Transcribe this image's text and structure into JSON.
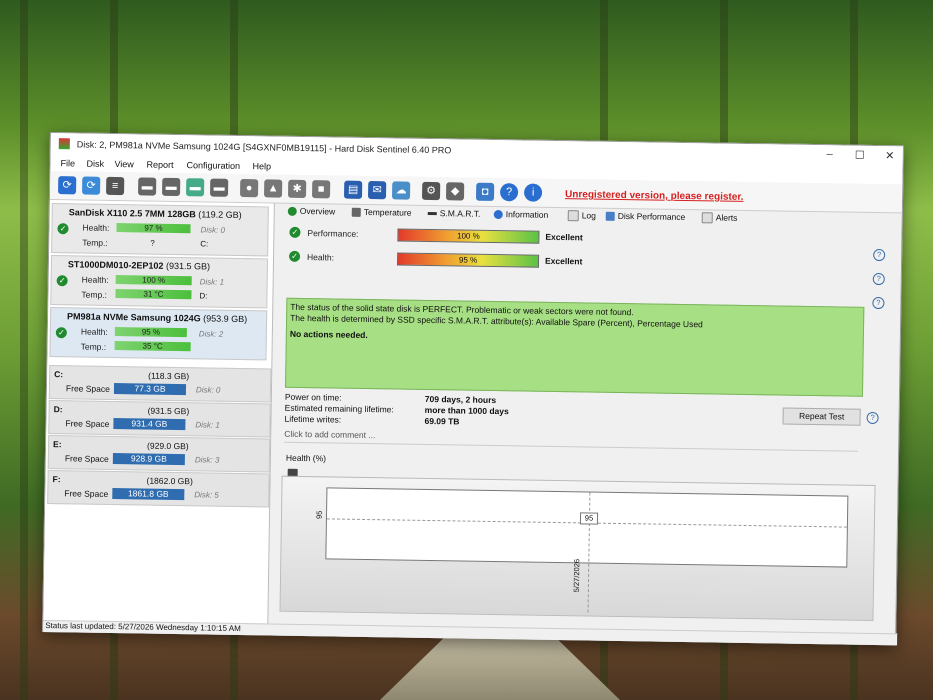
{
  "window": {
    "title": "Disk: 2, PM981a NVMe Samsung 1024G [S4GXNF0MB19115] - Hard Disk Sentinel 6.40 PRO",
    "minimize": "–",
    "maximize": "☐",
    "close": "✕"
  },
  "menu": [
    "File",
    "Disk",
    "View",
    "Report",
    "Configuration",
    "Help"
  ],
  "toolbar": {
    "unregistered": "Unregistered version, please register."
  },
  "disks": [
    {
      "name": "SanDisk X110 2.5 7MM 128GB",
      "size": "(119.2 GB)",
      "health_label": "Health:",
      "health": "97 %",
      "health_value": 97,
      "disk": "Disk: 0",
      "temp_label": "Temp.:",
      "temp": "?",
      "drive": "C:"
    },
    {
      "name": "ST1000DM010-2EP102",
      "size": "(931.5 GB)",
      "health_label": "Health:",
      "health": "100 %",
      "health_value": 100,
      "disk": "Disk: 1",
      "temp_label": "Temp.:",
      "temp": "31 °C",
      "drive": "D:"
    },
    {
      "name": "PM981a NVMe Samsung 1024G",
      "size": "(953.9 GB)",
      "health_label": "Health:",
      "health": "95 %",
      "health_value": 95,
      "disk": "Disk: 2",
      "temp_label": "Temp.:",
      "temp": "35 °C",
      "drive": ""
    }
  ],
  "volumes": [
    {
      "letter": "C:",
      "size": "(118.3 GB)",
      "free_label": "Free Space",
      "free": "77.3 GB",
      "disk": "Disk: 0"
    },
    {
      "letter": "D:",
      "size": "(931.5 GB)",
      "free_label": "Free Space",
      "free": "931.4 GB",
      "disk": "Disk: 1"
    },
    {
      "letter": "E:",
      "size": "(929.0 GB)",
      "free_label": "Free Space",
      "free": "928.9 GB",
      "disk": "Disk: 3"
    },
    {
      "letter": "F:",
      "size": "(1862.0 GB)",
      "free_label": "Free Space",
      "free": "1861.8 GB",
      "disk": "Disk: 5"
    }
  ],
  "tabs": [
    "Overview",
    "Temperature",
    "S.M.A.R.T.",
    "Information",
    "Log",
    "Disk Performance",
    "Alerts"
  ],
  "overview": {
    "performance_label": "Performance:",
    "performance": "100 %",
    "performance_rating": "Excellent",
    "health_label": "Health:",
    "health": "95 %",
    "health_rating": "Excellent",
    "status_line1": "The status of the solid state disk is PERFECT. Problematic or weak sectors were not found.",
    "status_line2": "The health is determined by SSD specific S.M.A.R.T. attribute(s):  Available Spare (Percent), Percentage Used",
    "status_line3": "No actions needed.",
    "power_on_label": "Power on time:",
    "power_on": "709 days, 2 hours",
    "remaining_label": "Estimated remaining lifetime:",
    "remaining": "more than 1000 days",
    "writes_label": "Lifetime writes:",
    "writes": "69.09 TB",
    "repeat_test": "Repeat Test",
    "comment_placeholder": "Click to add comment ...",
    "health_graph_title": "Health (%)"
  },
  "chart_data": {
    "type": "line",
    "title": "Health (%)",
    "x": [
      "5/27/2026"
    ],
    "series": [
      {
        "values": [
          95
        ]
      }
    ],
    "point_label": "95",
    "y_tick": "95",
    "x_tick": "5/27/2026"
  },
  "statusbar": "Status last updated: 5/27/2026 Wednesday 1:10:15 AM",
  "help": "?"
}
